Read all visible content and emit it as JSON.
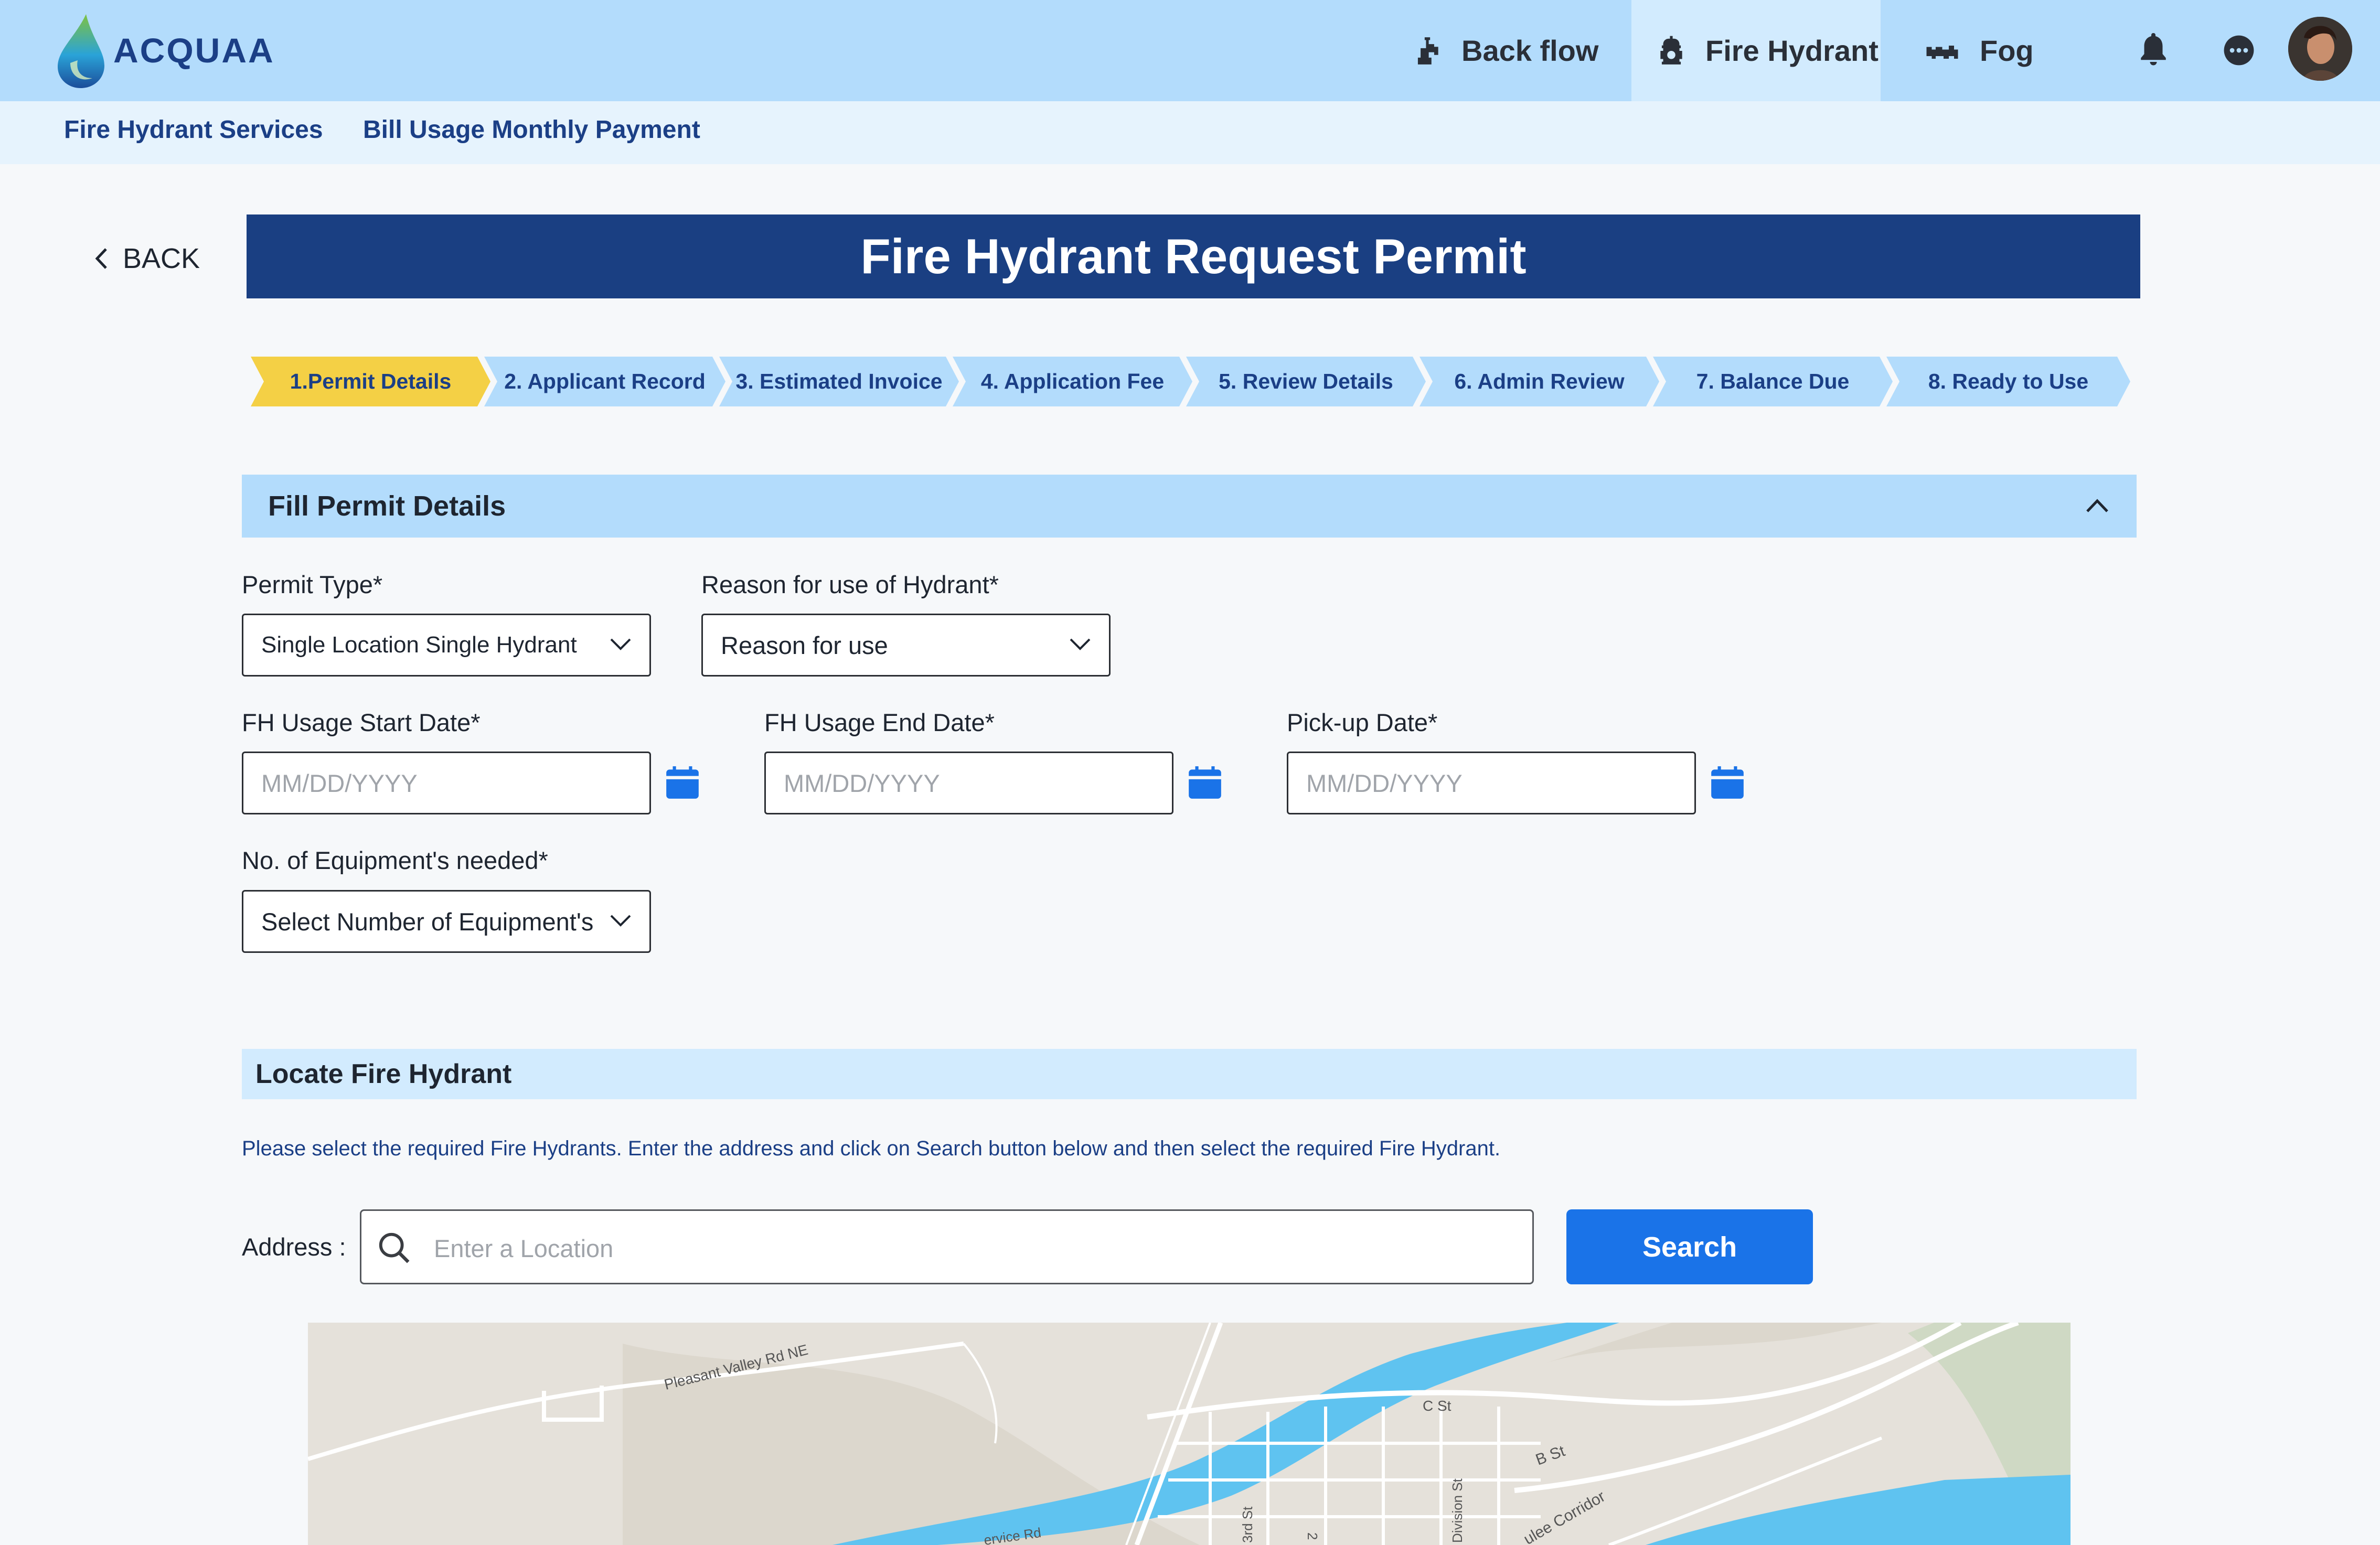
{
  "brand": {
    "name": "ACQUAA"
  },
  "nav": {
    "items": [
      {
        "label": "Back flow",
        "icon": "backflow-icon"
      },
      {
        "label": "Fire Hydrant",
        "icon": "fire-hydrant-icon",
        "active": true
      },
      {
        "label": "Fog",
        "icon": "fog-icon"
      }
    ],
    "notifications_icon": "bell-icon",
    "more_icon": "more-icon"
  },
  "subnav": {
    "items": [
      "Fire Hydrant Services",
      "Bill Usage Monthly Payment"
    ]
  },
  "back_label": "BACK",
  "page_title": "Fire Hydrant Request Permit",
  "steps": [
    "1.Permit Details",
    "2. Applicant Record",
    "3. Estimated Invoice",
    "4. Application Fee",
    "5. Review Details",
    "6. Admin Review",
    "7. Balance Due",
    "8. Ready to Use"
  ],
  "active_step": 0,
  "permit_section": {
    "title": "Fill Permit Details",
    "permit_type": {
      "label": "Permit Type*",
      "value": "Single Location Single Hydrant"
    },
    "reason": {
      "label": "Reason for use of Hydrant*",
      "value": "Reason for use"
    },
    "start_date": {
      "label": "FH Usage Start Date*",
      "placeholder": "MM/DD/YYYY"
    },
    "end_date": {
      "label": "FH Usage End Date*",
      "placeholder": "MM/DD/YYYY"
    },
    "pickup_date": {
      "label": "Pick-up Date*",
      "placeholder": "MM/DD/YYYY"
    },
    "equipment": {
      "label": "No. of Equipment's needed*",
      "value": "Select Number of Equipment's"
    }
  },
  "locate_section": {
    "title": "Locate Fire Hydrant",
    "info": "Please select the required Fire Hydrants. Enter the address and click on Search button below and then select the required Fire Hydrant.",
    "address_label": "Address :",
    "address_placeholder": "Enter a Location",
    "search_label": "Search"
  },
  "map_labels": {
    "road1": "Pleasant Valley Rd NE",
    "c_st": "C St",
    "b_st": "B St",
    "division_st": "Division St",
    "third_st": "3rd St",
    "corridor": "ulee Corridor",
    "service_rd": "ervice Rd",
    "two": "2"
  },
  "colors": {
    "nav_bg": "#b3dcfc",
    "title_bg": "#1a3f82",
    "active_step": "#f4d045",
    "accent": "#1a73e8"
  }
}
